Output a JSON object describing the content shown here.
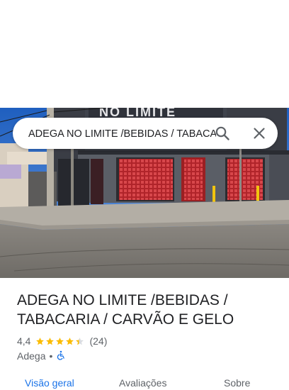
{
  "search": {
    "query": "ADEGA NO LIMITE /BEBIDAS / TABACARIA / CARVÃO E GELO"
  },
  "photo": {
    "sign_text": "NO LIMITE"
  },
  "place": {
    "title": "ADEGA NO LIMITE /BEBIDAS / TABACARIA / CARVÃO E GELO",
    "rating": "4,4",
    "rating_value": 4.4,
    "review_count": "(24)",
    "category": "Adega",
    "separator": "•",
    "accessibility_icon": "wheelchair-icon"
  },
  "tabs": [
    {
      "label": "Visão geral",
      "active": true
    },
    {
      "label": "Avaliações",
      "active": false
    },
    {
      "label": "Sobre",
      "active": false
    }
  ],
  "colors": {
    "star": "#fbbc04",
    "accent": "#1a73e8",
    "text_primary": "#202124",
    "text_secondary": "#5f6368",
    "accessibility": "#1a73e8"
  }
}
